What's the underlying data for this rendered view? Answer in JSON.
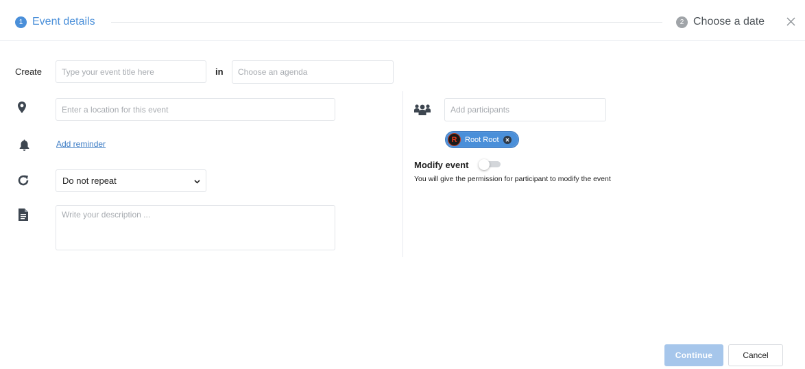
{
  "stepper": {
    "step1": {
      "number": "1",
      "label": "Event details"
    },
    "step2": {
      "number": "2",
      "label": "Choose a date"
    },
    "close_icon": "close-icon"
  },
  "form": {
    "create_label": "Create",
    "title_placeholder": "Type your event title here",
    "title_value": "",
    "in_label": "in",
    "agenda_placeholder": "Choose an agenda",
    "agenda_value": "",
    "location_placeholder": "Enter a location for this event",
    "location_value": "",
    "add_reminder_label": "Add reminder",
    "repeat_selected": "Do not repeat",
    "description_placeholder": "Write your description ...",
    "description_value": ""
  },
  "participants": {
    "placeholder": "Add participants",
    "value": "",
    "chips": [
      {
        "avatar_letter": "R",
        "label": "Root Root"
      }
    ],
    "modify_event_label": "Modify event",
    "modify_event_enabled": false,
    "modify_event_help": "You will give the permission for participant to modify the event"
  },
  "footer": {
    "continue_label": "Continue",
    "cancel_label": "Cancel"
  },
  "colors": {
    "accent": "#4a8fd9",
    "inactive_step": "#a0a4a8",
    "continue_disabled": "#a6c6eb",
    "link": "#3b7bc4"
  },
  "icons": [
    "map-marker-icon",
    "bell-icon",
    "refresh-icon",
    "file-text-icon",
    "users-icon",
    "close-icon",
    "chevron-down-icon"
  ]
}
